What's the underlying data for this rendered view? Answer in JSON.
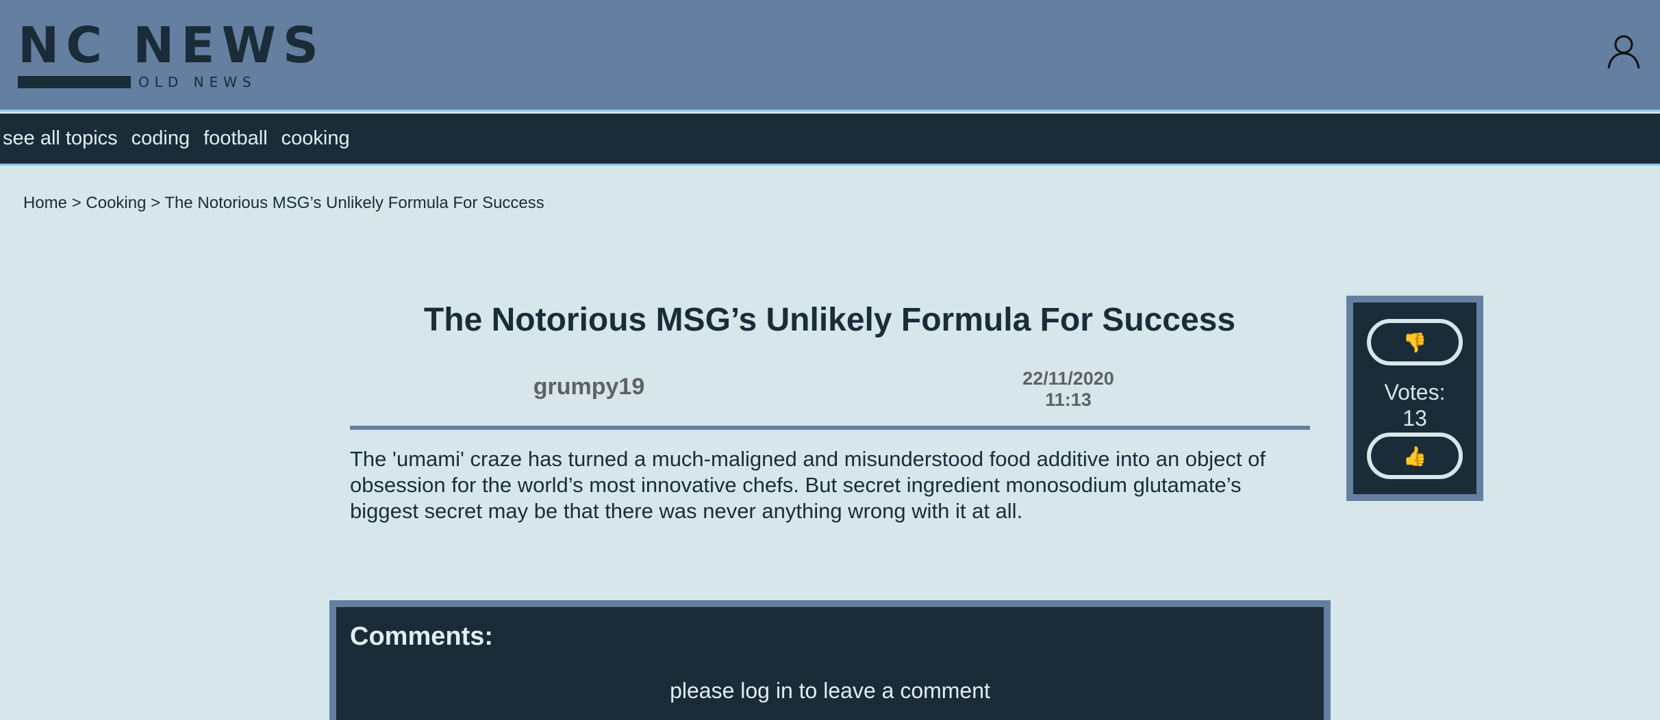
{
  "header": {
    "logo_title": "NC NEWS",
    "logo_subtitle": "OLD NEWS",
    "user_icon": "user-icon"
  },
  "nav": {
    "items": [
      "see all topics",
      "coding",
      "football",
      "cooking"
    ]
  },
  "breadcrumb": {
    "home": "Home",
    "sep1": " > ",
    "topic": "Cooking",
    "sep2": " > ",
    "current": "The Notorious MSG’s Unlikely Formula For Success"
  },
  "article": {
    "title": "The Notorious MSG’s Unlikely Formula For Success",
    "author": "grumpy19",
    "date": "22/11/2020",
    "time": "11:13",
    "body": "The 'umami' craze has turned a much-maligned and misunderstood food additive into an object of obsession for the world’s most innovative chefs. But secret ingredient monosodium glutamate’s biggest secret may be that there was never anything wrong with it at all."
  },
  "votes": {
    "downvote_icon": "👎",
    "upvote_icon": "👍",
    "label": "Votes:",
    "count": "13"
  },
  "comments": {
    "heading": "Comments:",
    "message": "please log in to leave a comment"
  },
  "colors": {
    "background": "#d6e6eb",
    "header": "#647fa0",
    "dark": "#1a2c38",
    "accent_line": "#8ec4e6"
  }
}
